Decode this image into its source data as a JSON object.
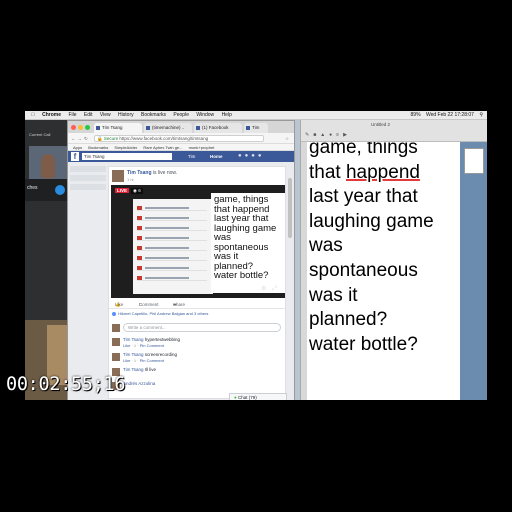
{
  "menubar": {
    "app": "Chrome",
    "items": [
      "File",
      "Edit",
      "View",
      "History",
      "Bookmarks",
      "People",
      "Window",
      "Help"
    ],
    "clock": "Wed Feb 22 17:28:07",
    "battery": "89%"
  },
  "call": {
    "label": "Current Call",
    "name": "ches"
  },
  "sidepanel": {
    "disable": "Disable"
  },
  "chrome": {
    "tabs": [
      "Tim Tsang",
      "(timemachine) ..",
      "(1) Facebook"
    ],
    "extra_tab": "Tim",
    "secure": "Secure",
    "url": "https://www.facebook.com/timtsang/timtsang",
    "bookmarks": [
      "Apps",
      "Bookmarks",
      "SimpleAdder",
      "Rare Aphex Twin ge...",
      "monk+prophet"
    ]
  },
  "facebook": {
    "search_value": "Tim Tsang",
    "user": "Tim",
    "home": "Home",
    "post": {
      "author": "Tim Tsang",
      "status": "is live now.",
      "time": "1 hr",
      "live_badge": "LIVE",
      "viewers": "6",
      "video_text": [
        "game, things",
        "that happend",
        "last year that",
        "laughing game",
        "was",
        "spontaneous",
        "was it",
        "planned?",
        "water bottle?"
      ],
      "actions": [
        "Like",
        "Comment",
        "Share"
      ],
      "reactions": "Hikmet Capetillo, Phil Andrew Balgian and 3 others",
      "write_placeholder": "Write a comment...",
      "comments": [
        {
          "author": "Tim Tsang",
          "text": "hypertextwebbing",
          "meta": [
            "Like",
            "1",
            "Pin Comment"
          ]
        },
        {
          "author": "Tim Tsang",
          "text": "screenrecording",
          "meta": [
            "Like",
            "1",
            "Pin Comment"
          ]
        },
        {
          "author": "Tim Tsang",
          "text": "Ill live",
          "meta": []
        },
        {
          "author": "Andrés Azzolina",
          "text": "",
          "meta": []
        }
      ],
      "chat": "Chat (79)"
    }
  },
  "document": {
    "title": "Untitled 2",
    "lines": [
      "game, things",
      "that happend",
      "last year that",
      "laughing game",
      "was",
      "spontaneous",
      "was it",
      "planned?",
      "water bottle?"
    ],
    "underlined_word": "happend"
  },
  "timecode": "00:02:55;16"
}
